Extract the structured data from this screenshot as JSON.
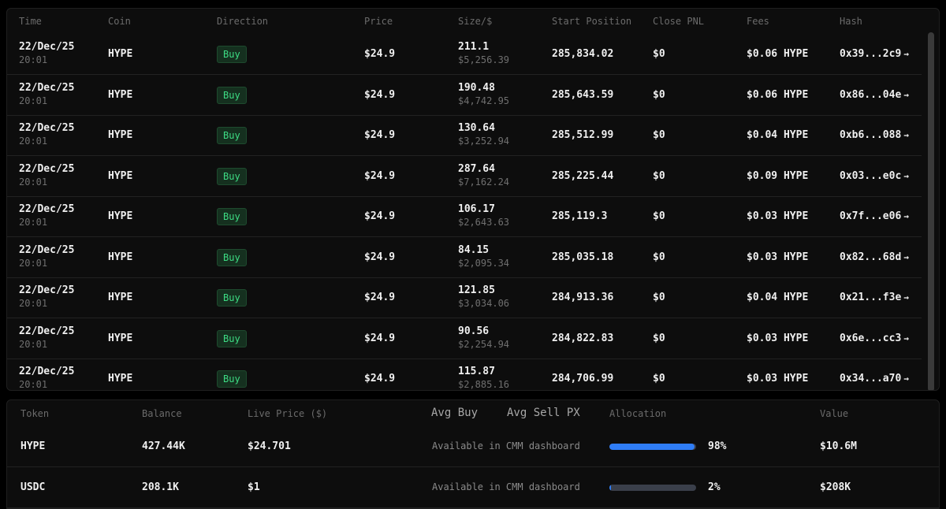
{
  "trades": {
    "columns": {
      "time": "Time",
      "coin": "Coin",
      "direction": "Direction",
      "price": "Price",
      "size": "Size/$",
      "start_position": "Start Position",
      "close_pnl": "Close PNL",
      "fees": "Fees",
      "hash": "Hash"
    },
    "rows": [
      {
        "date": "22/Dec/25",
        "time": "20:01",
        "coin": "HYPE",
        "direction": "Buy",
        "price": "$24.9",
        "size": "211.1",
        "size_usd": "$5,256.39",
        "start_position": "285,834.02",
        "close_pnl": "$0",
        "fees": "$0.06 HYPE",
        "hash": "0x39...2c9"
      },
      {
        "date": "22/Dec/25",
        "time": "20:01",
        "coin": "HYPE",
        "direction": "Buy",
        "price": "$24.9",
        "size": "190.48",
        "size_usd": "$4,742.95",
        "start_position": "285,643.59",
        "close_pnl": "$0",
        "fees": "$0.06 HYPE",
        "hash": "0x86...04e"
      },
      {
        "date": "22/Dec/25",
        "time": "20:01",
        "coin": "HYPE",
        "direction": "Buy",
        "price": "$24.9",
        "size": "130.64",
        "size_usd": "$3,252.94",
        "start_position": "285,512.99",
        "close_pnl": "$0",
        "fees": "$0.04 HYPE",
        "hash": "0xb6...088"
      },
      {
        "date": "22/Dec/25",
        "time": "20:01",
        "coin": "HYPE",
        "direction": "Buy",
        "price": "$24.9",
        "size": "287.64",
        "size_usd": "$7,162.24",
        "start_position": "285,225.44",
        "close_pnl": "$0",
        "fees": "$0.09 HYPE",
        "hash": "0x03...e0c"
      },
      {
        "date": "22/Dec/25",
        "time": "20:01",
        "coin": "HYPE",
        "direction": "Buy",
        "price": "$24.9",
        "size": "106.17",
        "size_usd": "$2,643.63",
        "start_position": "285,119.3",
        "close_pnl": "$0",
        "fees": "$0.03 HYPE",
        "hash": "0x7f...e06"
      },
      {
        "date": "22/Dec/25",
        "time": "20:01",
        "coin": "HYPE",
        "direction": "Buy",
        "price": "$24.9",
        "size": "84.15",
        "size_usd": "$2,095.34",
        "start_position": "285,035.18",
        "close_pnl": "$0",
        "fees": "$0.03 HYPE",
        "hash": "0x82...68d"
      },
      {
        "date": "22/Dec/25",
        "time": "20:01",
        "coin": "HYPE",
        "direction": "Buy",
        "price": "$24.9",
        "size": "121.85",
        "size_usd": "$3,034.06",
        "start_position": "284,913.36",
        "close_pnl": "$0",
        "fees": "$0.04 HYPE",
        "hash": "0x21...f3e"
      },
      {
        "date": "22/Dec/25",
        "time": "20:01",
        "coin": "HYPE",
        "direction": "Buy",
        "price": "$24.9",
        "size": "90.56",
        "size_usd": "$2,254.94",
        "start_position": "284,822.83",
        "close_pnl": "$0",
        "fees": "$0.03 HYPE",
        "hash": "0x6e...cc3"
      },
      {
        "date": "22/Dec/25",
        "time": "20:01",
        "coin": "HYPE",
        "direction": "Buy",
        "price": "$24.9",
        "size": "115.87",
        "size_usd": "$2,885.16",
        "start_position": "284,706.99",
        "close_pnl": "$0",
        "fees": "$0.03 HYPE",
        "hash": "0x34...a70"
      }
    ]
  },
  "portfolio": {
    "columns": {
      "token": "Token",
      "balance": "Balance",
      "live_price": "Live Price ($)",
      "avg_buy": "Avg Buy",
      "avg_sell": "Avg Sell PX",
      "allocation": "Allocation",
      "value": "Value"
    },
    "rows": [
      {
        "token": "HYPE",
        "balance": "427.44K",
        "live_price": "$24.701",
        "avg_note": "Available in CMM dashboard",
        "allocation_pct": 98,
        "allocation_label": "98%",
        "value": "$10.6M"
      },
      {
        "token": "USDC",
        "balance": "208.1K",
        "live_price": "$1",
        "avg_note": "Available in CMM dashboard",
        "allocation_pct": 2,
        "allocation_label": "2%",
        "value": "$208K"
      }
    ]
  },
  "colors": {
    "buy_text": "#3ddc84",
    "allocation_bar": "#2f7df6",
    "allocation_track": "#3a3f4a"
  },
  "icons": {
    "hash_link": "arrow-right-icon"
  }
}
